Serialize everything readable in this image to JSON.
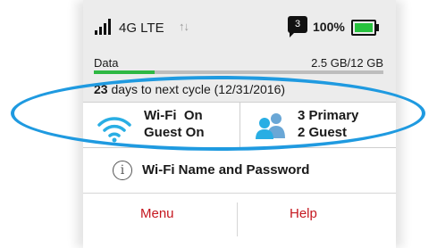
{
  "status_bar": {
    "network": "4G LTE",
    "arrows_icon": "up-down-arrows-icon",
    "messages_count": "3",
    "battery_percent": "100%",
    "battery_level": 1.0,
    "signal_bars": 4
  },
  "usage": {
    "label": "Data",
    "value": "2.5 GB/12 GB",
    "fraction": 0.21
  },
  "cycle": {
    "days": "23",
    "text": " days to next cycle (12/31/2016)"
  },
  "wifi": {
    "line1": "Wi-Fi  On",
    "line2": "Guest On",
    "icon": "wifi-icon"
  },
  "users": {
    "line1": "3 Primary",
    "line2": "2 Guest",
    "icon": "users-icon"
  },
  "wifi_name": {
    "label": "Wi-Fi Name and Password",
    "icon": "info-icon"
  },
  "nav": {
    "menu": "Menu",
    "help": "Help"
  },
  "colors": {
    "accent_red": "#c5171f",
    "highlight_blue": "#1f9ae0",
    "wifi_blue": "#29aee4",
    "usage_green": "#2eb843"
  }
}
